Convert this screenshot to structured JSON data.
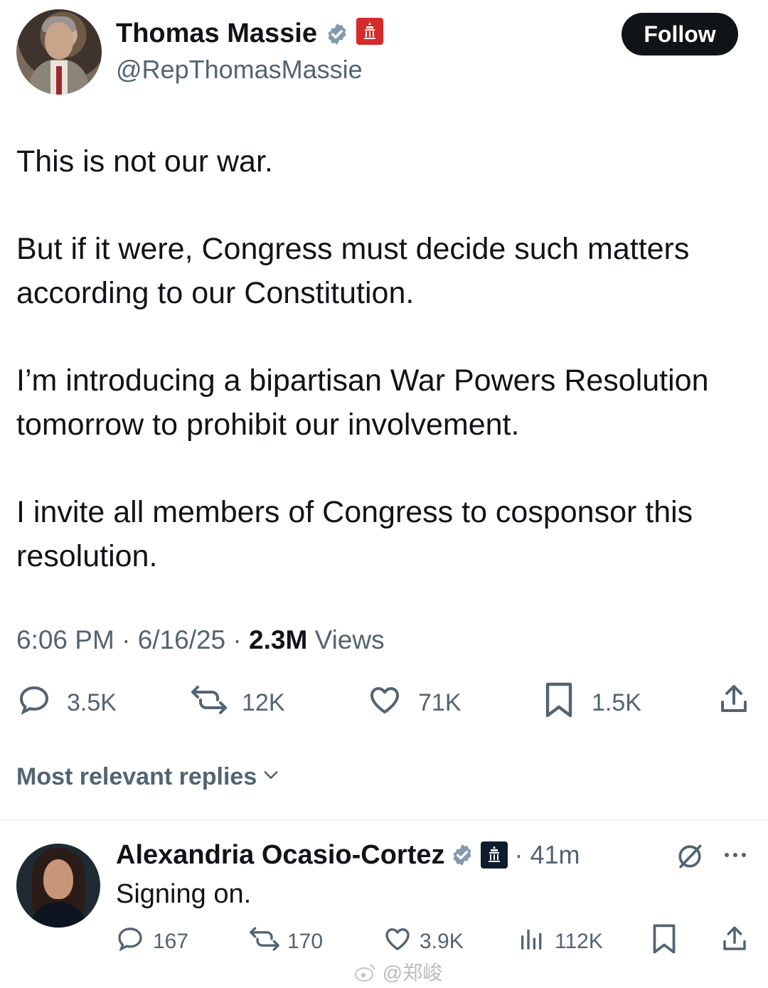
{
  "author": {
    "name": "Thomas Massie",
    "handle": "@RepThomasMassie",
    "follow_label": "Follow"
  },
  "tweet": {
    "paragraphs": [
      "This is not our war.",
      "But if it were, Congress must decide such matters according to our Constitution.",
      "I’m introducing a bipartisan War Powers Resolution tomorrow to prohibit our involvement.",
      "I invite all members of Congress to cosponsor this resolution."
    ],
    "time": "6:06 PM",
    "date": "6/16/25",
    "views_count": "2.3M",
    "views_label": "Views",
    "separator": "·"
  },
  "actions": {
    "replies": "3.5K",
    "reposts": "12K",
    "likes": "71K",
    "bookmarks": "1.5K"
  },
  "replies_section": {
    "label": "Most relevant replies"
  },
  "reply": {
    "name": "Alexandria Ocasio-Cortez",
    "time": "· 41m",
    "text": "Signing on.",
    "replies": "167",
    "reposts": "170",
    "likes": "3.9K",
    "views": "112K"
  },
  "watermark": "@郑峻",
  "colors": {
    "text": "#0f1419",
    "secondary": "#536471",
    "verified": "#829aab",
    "follow_bg": "#0f1419",
    "gop_badge": "#d52b2b"
  }
}
